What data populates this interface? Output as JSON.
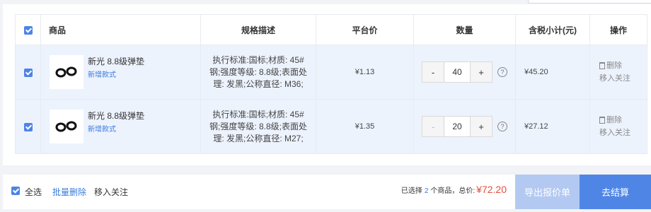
{
  "header": {
    "columns": {
      "product": "商品",
      "spec": "规格描述",
      "price": "平台价",
      "quantity": "数量",
      "subtotal": "含税小计(元)",
      "actions": "操作"
    }
  },
  "items": [
    {
      "checked": true,
      "name": "新光 8.8级弹垫",
      "tag": "新增款式",
      "spec": "执行标准:国标;材质: 45#钢;强度等级: 8.8级;表面处理: 发黑;公称直径: M36;",
      "price": "¥1.13",
      "quantity": "40",
      "minus": "-",
      "plus": "+",
      "help": "?",
      "subtotal": "¥45.20",
      "delete_label": "删除",
      "follow_label": "移入关注"
    },
    {
      "checked": true,
      "name": "新光 8.8级弹垫",
      "tag": "新增款式",
      "spec": "执行标准:国标;材质: 45#钢;强度等级: 8.8级;表面处理: 发黑;公称直径: M27;",
      "price": "¥1.35",
      "quantity": "20",
      "minus": "-",
      "plus": "+",
      "help": "?",
      "subtotal": "¥27.12",
      "delete_label": "删除",
      "follow_label": "移入关注"
    }
  ],
  "footer": {
    "select_all_label": "全选",
    "batch_delete_label": "批量删除",
    "follow_label": "移入关注",
    "selected_prefix": "已选择",
    "selected_count": "2",
    "selected_suffix": "个商品，总价:",
    "total": "¥72.20",
    "export_button": "导出报价单",
    "checkout_button": "去结算"
  },
  "colors": {
    "accent": "#4f86e6",
    "row_highlight": "#edf3fd",
    "price_red": "#e84d3d",
    "export_disabled": "#b3c9f1"
  },
  "icons": [
    "checkbox-checked-icon",
    "trash-icon",
    "question-circle-icon",
    "spring-washer-image"
  ]
}
